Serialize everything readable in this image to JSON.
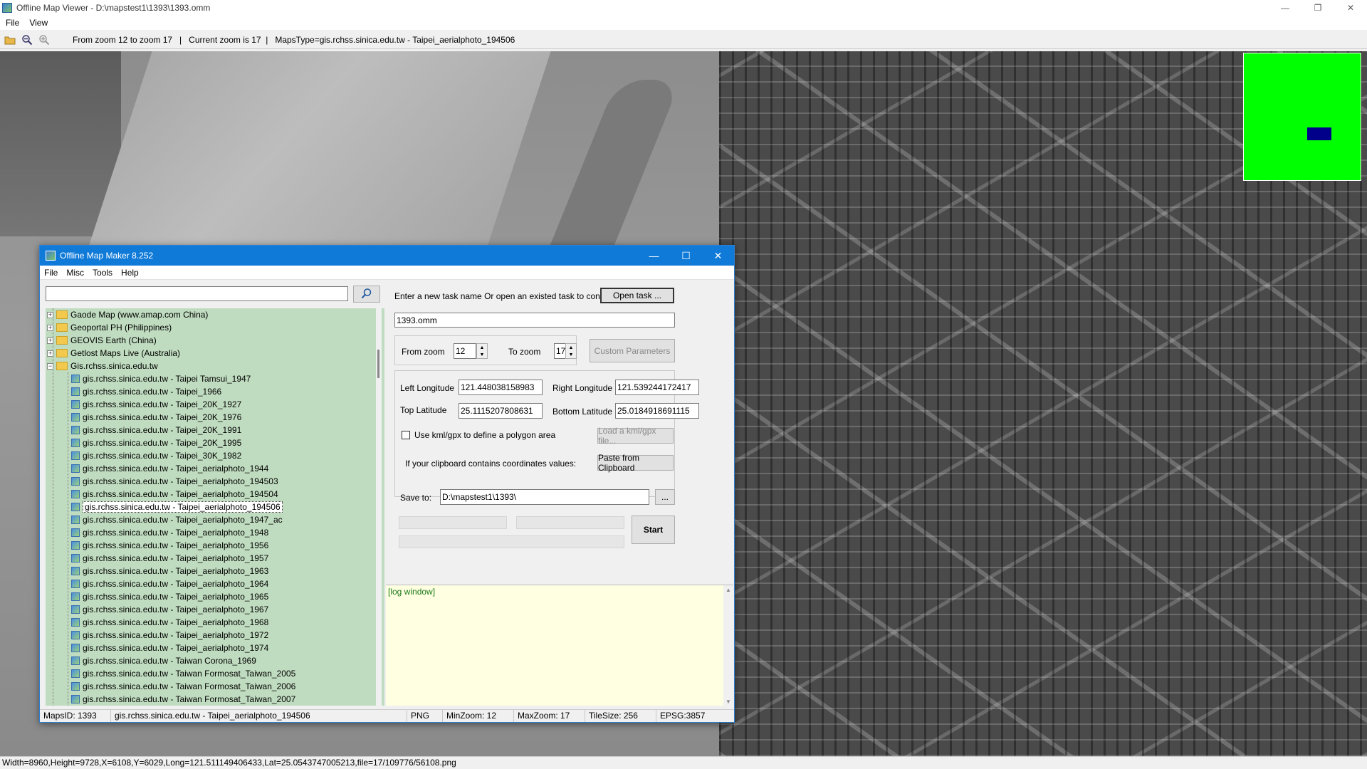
{
  "window": {
    "title": "Offline Map Viewer - D:\\mapstest1\\1393\\1393.omm",
    "controls": {
      "minimize": "—",
      "restore": "❐",
      "close": "✕"
    }
  },
  "menu": [
    "File",
    "View"
  ],
  "toolbar": {
    "icons": [
      "open-folder-icon",
      "zoom-out-icon",
      "zoom-in-icon"
    ],
    "status": "From zoom 12 to zoom 17   |   Current zoom is 17  |   MapsType=gis.rchss.sinica.edu.tw - Taipei_aerialphoto_194506"
  },
  "statusbar": "Width=8960,Height=9728,X=6108,Y=6029,Long=121.511149406433,Lat=25.0543747005213,file=17/109776/56108.png",
  "minimap": {
    "background": "#00ff00",
    "viewport_color": "#00008b"
  },
  "dialog": {
    "title": "Offline Map Maker 8.252",
    "controls": {
      "minimize": "—",
      "maximize": "☐",
      "close": "✕"
    },
    "menu": [
      "File",
      "Misc",
      "Tools",
      "Help"
    ],
    "search": {
      "value": "",
      "button_icon": "search-icon"
    },
    "tree": {
      "folders": [
        {
          "label": "Gaode Map (www.amap.com China)",
          "expanded": false
        },
        {
          "label": "Geoportal PH (Philippines)",
          "expanded": false
        },
        {
          "label": "GEOVIS Earth (China)",
          "expanded": false
        },
        {
          "label": "Getlost Maps Live (Australia)",
          "expanded": false
        },
        {
          "label": "Gis.rchss.sinica.edu.tw",
          "expanded": true
        }
      ],
      "children": [
        "gis.rchss.sinica.edu.tw - Taipei Tamsui_1947",
        "gis.rchss.sinica.edu.tw - Taipei_1966",
        "gis.rchss.sinica.edu.tw - Taipei_20K_1927",
        "gis.rchss.sinica.edu.tw - Taipei_20K_1976",
        "gis.rchss.sinica.edu.tw - Taipei_20K_1991",
        "gis.rchss.sinica.edu.tw - Taipei_20K_1995",
        "gis.rchss.sinica.edu.tw - Taipei_30K_1982",
        "gis.rchss.sinica.edu.tw - Taipei_aerialphoto_1944",
        "gis.rchss.sinica.edu.tw - Taipei_aerialphoto_194503",
        "gis.rchss.sinica.edu.tw - Taipei_aerialphoto_194504",
        "gis.rchss.sinica.edu.tw - Taipei_aerialphoto_194506",
        "gis.rchss.sinica.edu.tw - Taipei_aerialphoto_1947_ac",
        "gis.rchss.sinica.edu.tw - Taipei_aerialphoto_1948",
        "gis.rchss.sinica.edu.tw - Taipei_aerialphoto_1956",
        "gis.rchss.sinica.edu.tw - Taipei_aerialphoto_1957",
        "gis.rchss.sinica.edu.tw - Taipei_aerialphoto_1963",
        "gis.rchss.sinica.edu.tw - Taipei_aerialphoto_1964",
        "gis.rchss.sinica.edu.tw - Taipei_aerialphoto_1965",
        "gis.rchss.sinica.edu.tw - Taipei_aerialphoto_1967",
        "gis.rchss.sinica.edu.tw - Taipei_aerialphoto_1968",
        "gis.rchss.sinica.edu.tw - Taipei_aerialphoto_1972",
        "gis.rchss.sinica.edu.tw - Taipei_aerialphoto_1974",
        "gis.rchss.sinica.edu.tw - Taiwan Corona_1969",
        "gis.rchss.sinica.edu.tw - Taiwan Formosat_Taiwan_2005",
        "gis.rchss.sinica.edu.tw - Taiwan Formosat_Taiwan_2006",
        "gis.rchss.sinica.edu.tw - Taiwan Formosat_Taiwan_2007"
      ],
      "selected": "gis.rchss.sinica.edu.tw - Taipei_aerialphoto_194506",
      "background": "#c0dcc0"
    },
    "task": {
      "prompt": "Enter a new task name Or open an existed task to continue:",
      "open_button": "Open task ...",
      "name": "1393.omm"
    },
    "zoom": {
      "from_label": "From zoom",
      "from_value": "12",
      "to_label": "To zoom",
      "to_value": "17",
      "custom_button": "Custom Parameters"
    },
    "bounds": {
      "left_lon_label": "Left Longitude",
      "left_lon": "121.448038158983",
      "right_lon_label": "Right Longitude",
      "right_lon": "121.539244172417",
      "top_lat_label": "Top Latitude",
      "top_lat": "25.1115207808631",
      "bottom_lat_label": "Bottom Latitude",
      "bottom_lat": "25.0184918691115",
      "kml_checkbox_label": "Use kml/gpx to define a polygon area",
      "kml_checked": false,
      "kml_button": "Load a kml/gpx file...",
      "clipboard_label": "If your clipboard contains coordinates values:",
      "clipboard_button": "Paste from Clipboard"
    },
    "save": {
      "label": "Save to:",
      "path": "D:\\mapstest1\\1393\\",
      "browse_button": "..."
    },
    "start_button": "Start",
    "log_text": "[log window]",
    "status": {
      "maps_id": "MapsID: 1393",
      "map_name": "gis.rchss.sinica.edu.tw - Taipei_aerialphoto_194506",
      "format": "PNG",
      "min_zoom": "MinZoom: 12",
      "max_zoom": "MaxZoom: 17",
      "tile_size": "TileSize: 256",
      "epsg": "EPSG:3857"
    }
  }
}
